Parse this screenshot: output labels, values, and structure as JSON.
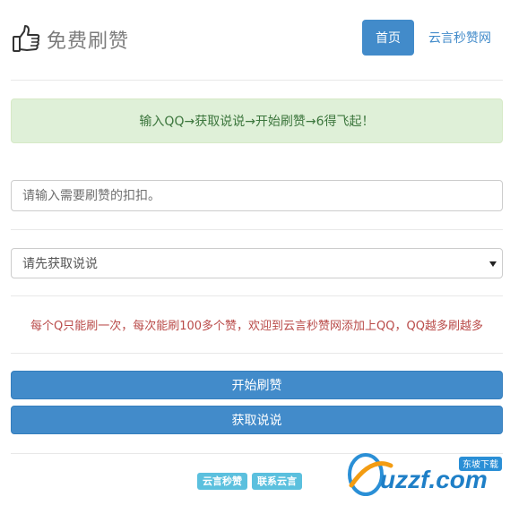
{
  "header": {
    "title": "免费刷赞",
    "logo_icon": "thumbs-up-icon",
    "nav": {
      "home_label": "首页",
      "site_label": "云言秒赞网"
    }
  },
  "alert": {
    "text": "输入QQ→获取说说→开始刷赞→6得飞起！"
  },
  "form": {
    "qq_input": {
      "value": "",
      "placeholder": "请输入需要刷赞的扣扣。"
    },
    "shuoshuo_select": {
      "selected": "请先获取说说"
    },
    "notice": "每个Q只能刷一次，每次能刷100多个赞，欢迎到云言秒赞网添加上QQ，QQ越多刷越多",
    "start_button": "开始刷赞",
    "fetch_button": "获取说说"
  },
  "footer": {
    "badge_1": "云言秒赞",
    "badge_2": "联系云言"
  },
  "watermark": {
    "main": "uzzf.com",
    "sub": "东坡下载"
  },
  "colors": {
    "primary": "#428bca",
    "success_bg": "#dff0d8",
    "success_text": "#3c763d",
    "danger_text": "#b94a48",
    "info": "#5bc0de"
  }
}
